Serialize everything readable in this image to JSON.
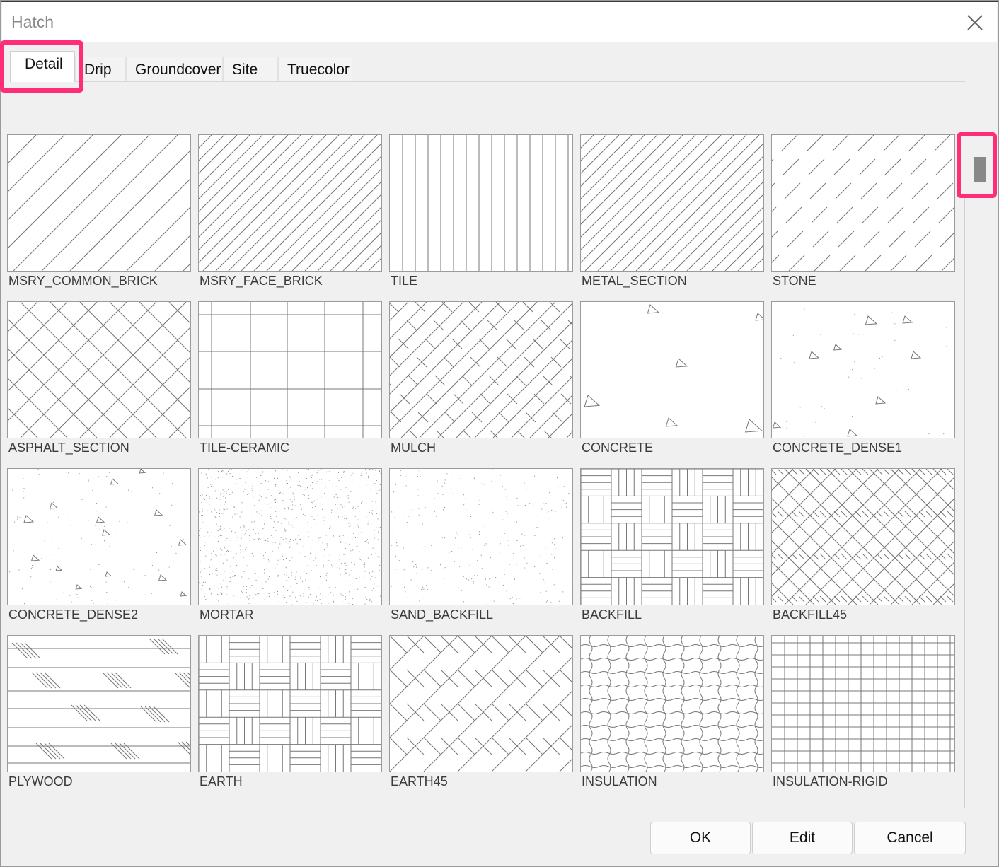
{
  "window": {
    "title": "Hatch"
  },
  "tabs": [
    {
      "label": "Detail",
      "active": true
    },
    {
      "label": "Drip"
    },
    {
      "label": "Groundcover"
    },
    {
      "label": "Site"
    },
    {
      "label": "Truecolor"
    }
  ],
  "patterns": [
    {
      "name": "MSRY_COMMON_BRICK",
      "icon": "diagonal-hatch"
    },
    {
      "name": "MSRY_FACE_BRICK",
      "icon": "dense-diagonal-hatch"
    },
    {
      "name": "TILE",
      "icon": "vertical-lines"
    },
    {
      "name": "METAL_SECTION",
      "icon": "dense-diagonal-hatch"
    },
    {
      "name": "STONE",
      "icon": "dashed-diagonal-hatch"
    },
    {
      "name": "ASPHALT_SECTION",
      "icon": "cross-hatch"
    },
    {
      "name": "TILE-CERAMIC",
      "icon": "grid"
    },
    {
      "name": "MULCH",
      "icon": "broken-cross-hatch"
    },
    {
      "name": "CONCRETE",
      "icon": "concrete"
    },
    {
      "name": "CONCRETE_DENSE1",
      "icon": "concrete-dense"
    },
    {
      "name": "CONCRETE_DENSE2",
      "icon": "concrete-dense-dots"
    },
    {
      "name": "MORTAR",
      "icon": "dots-dense"
    },
    {
      "name": "SAND_BACKFILL",
      "icon": "dots-sparse"
    },
    {
      "name": "BACKFILL",
      "icon": "basketweave"
    },
    {
      "name": "BACKFILL45",
      "icon": "basketweave-45"
    },
    {
      "name": "PLYWOOD",
      "icon": "plywood"
    },
    {
      "name": "EARTH",
      "icon": "basketweave-earth"
    },
    {
      "name": "EARTH45",
      "icon": "herringbone"
    },
    {
      "name": "INSULATION",
      "icon": "wavy-grid"
    },
    {
      "name": "INSULATION-RIGID",
      "icon": "small-grid"
    }
  ],
  "buttons": {
    "ok": "OK",
    "edit": "Edit",
    "cancel": "Cancel"
  },
  "colors": {
    "highlight": "#ff2d78",
    "background": "#f0f0f0"
  }
}
